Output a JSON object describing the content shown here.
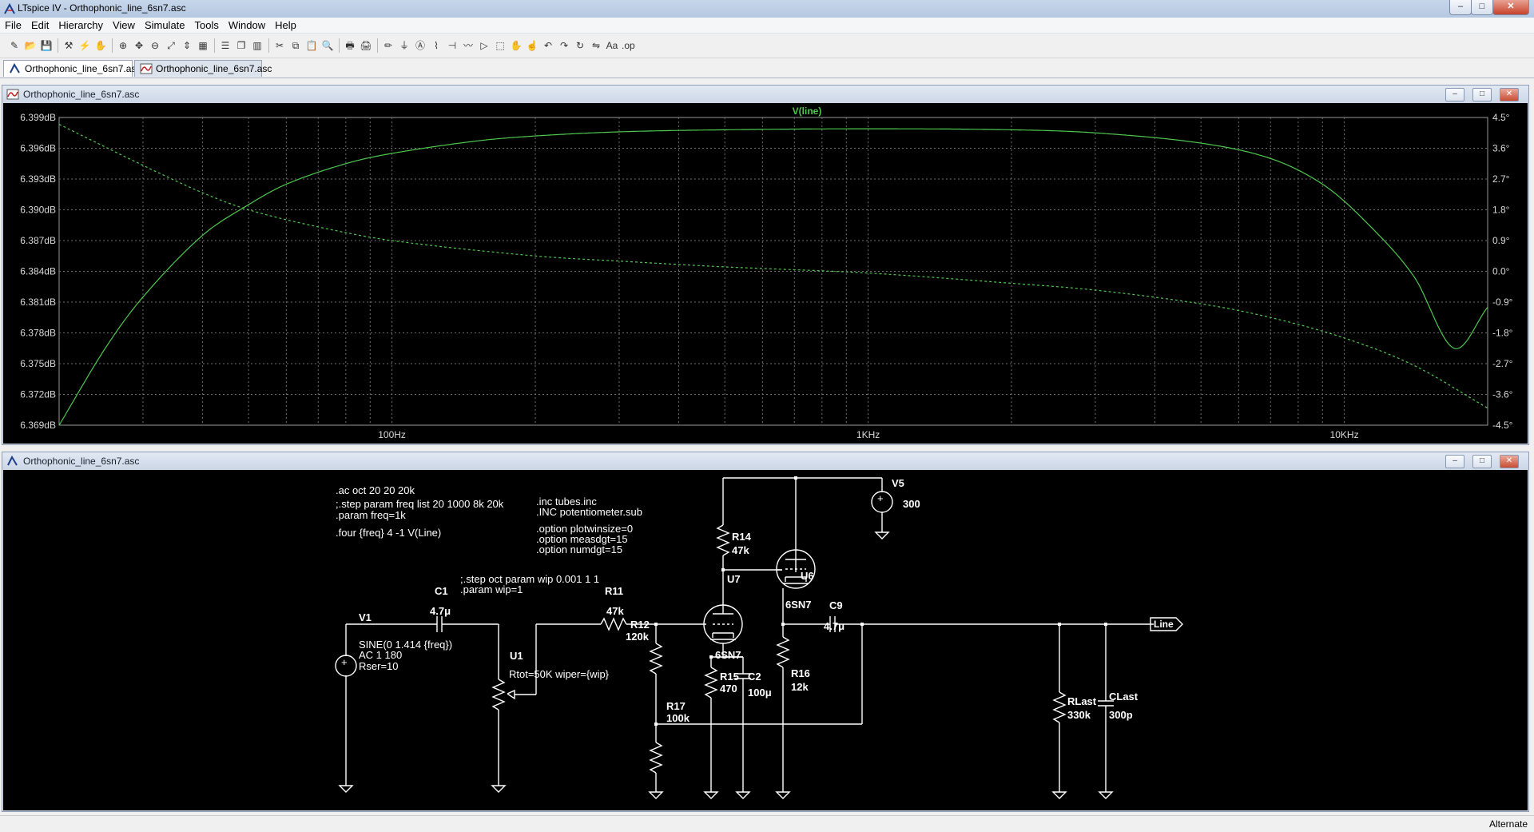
{
  "window": {
    "title": "LTspice IV - Orthophonic_line_6sn7.asc",
    "min_label": "–",
    "max_label": "□",
    "close_label": "✕"
  },
  "menu": [
    "File",
    "Edit",
    "Hierarchy",
    "View",
    "Simulate",
    "Tools",
    "Window",
    "Help"
  ],
  "toolbar_icons": [
    "new-schematic-icon",
    "open-icon",
    "save-icon",
    "control-panel-icon",
    "run-icon",
    "halt-icon",
    "zoom-in-icon",
    "pan-icon",
    "zoom-out-icon",
    "zoom-fit-icon",
    "autorange-icon",
    "grid-icon",
    "tile-horizontal-icon",
    "cascade-icon",
    "tile-vertical-icon",
    "cut-icon",
    "copy-icon",
    "paste-icon",
    "find-icon",
    "print-setup-icon",
    "print-icon",
    "draw-wire-icon",
    "ground-icon",
    "label-net-icon",
    "resistor-icon",
    "capacitor-icon",
    "inductor-icon",
    "diode-icon",
    "component-icon",
    "move-icon",
    "drag-icon",
    "undo-icon",
    "redo-icon",
    "rotate-icon",
    "mirror-icon",
    "text-icon",
    "spice-directive-icon"
  ],
  "tabs": [
    {
      "label": "Orthophonic_line_6sn7.asc",
      "icon": "schematic-icon"
    },
    {
      "label": "Orthophonic_line_6sn7.asc",
      "icon": "waveform-icon"
    }
  ],
  "waveform_window": {
    "title": "Orthophonic_line_6sn7.asc",
    "trace_name": "V(line)",
    "trace_color": "#4fc84f",
    "background": "#000000"
  },
  "chart_data": {
    "type": "line",
    "title": "V(line)",
    "xscale": "log",
    "xlim": [
      20,
      20000
    ],
    "x_tick_labels": [
      "100Hz",
      "1KHz",
      "10KHz"
    ],
    "x_ticks": [
      100,
      1000,
      10000
    ],
    "y_left_ticks": [
      "6.399dB",
      "6.396dB",
      "6.393dB",
      "6.390dB",
      "6.387dB",
      "6.384dB",
      "6.381dB",
      "6.378dB",
      "6.375dB",
      "6.372dB",
      "6.369dB"
    ],
    "y_left_lim": [
      6.369,
      6.399
    ],
    "y_right_ticks": [
      "4.5°",
      "3.6°",
      "2.7°",
      "1.8°",
      "0.9°",
      "0.0°",
      "-0.9°",
      "-1.8°",
      "-2.7°",
      "-3.6°",
      "-4.5°"
    ],
    "y_right_lim": [
      -4.5,
      4.5
    ],
    "grid": true,
    "series": [
      {
        "name": "V(line)",
        "style": "solid",
        "x": [
          20,
          25,
          30,
          40,
          50,
          60,
          80,
          100,
          150,
          200,
          300,
          500,
          1000,
          2000,
          3000,
          5000,
          7000,
          9000,
          11000,
          14000,
          17000,
          20000
        ],
        "y": [
          6.369,
          6.3765,
          6.3815,
          6.3875,
          6.3905,
          6.3925,
          6.3945,
          6.3955,
          6.3967,
          6.3972,
          6.3976,
          6.3978,
          6.3979,
          6.3978,
          6.3975,
          6.3965,
          6.395,
          6.3925,
          6.389,
          6.3835,
          6.3765,
          6.3805
        ]
      },
      {
        "name": "phase",
        "style": "dashed",
        "x": [
          20,
          30,
          40,
          50,
          70,
          100,
          200,
          300,
          500,
          1000,
          2000,
          3000,
          5000,
          7000,
          10000,
          14000,
          20000
        ],
        "y": [
          4.3,
          3.1,
          2.3,
          1.8,
          1.3,
          0.9,
          0.45,
          0.3,
          0.13,
          -0.05,
          -0.35,
          -0.55,
          -0.95,
          -1.35,
          -1.95,
          -2.75,
          -4.0
        ]
      }
    ]
  },
  "schematic_window": {
    "title": "Orthophonic_line_6sn7.asc",
    "background": "#000000",
    "wire_color": "#ffffff",
    "directives": {
      "d1": ".ac oct 20 20 20k",
      "d2": ";.step param freq list 20 1000 8k 20k",
      "d3": ".param freq=1k",
      "d4": ".four {freq} 4 -1 V(Line)",
      "d5": ".inc tubes.inc",
      "d6": ".INC potentiometer.sub",
      "d7": ".option plotwinsize=0",
      "d8": ".option measdgt=15",
      "d9": ".option numdgt=15",
      "d10": ";.step oct param wip 0.001 1 1",
      "d11": ".param wip=1"
    },
    "components": {
      "v1_name": "V1",
      "v1_val1": "SINE(0 1.414 {freq})",
      "v1_val2": "AC 1 180",
      "v1_val3": "Rser=10",
      "c1_name": "C1",
      "c1_val": "4.7μ",
      "u1_name": "U1",
      "u1_val": "Rtot=50K wiper={wip}",
      "r11_name": "R11",
      "r11_val": "47k",
      "r12_name": "R12",
      "r12_val": "120k",
      "r17_name": "R17",
      "r17_val": "100k",
      "u7_name": "U7",
      "u7_val": "6SN7",
      "r15_name": "R15",
      "r15_val": "470",
      "c2_name": "C2",
      "c2_val": "100μ",
      "r14_name": "R14",
      "r14_val": "47k",
      "u6_name": "U6",
      "u6_val": "6SN7",
      "r16_name": "R16",
      "r16_val": "12k",
      "c9_name": "C9",
      "c9_val": "4.7μ",
      "v5_name": "V5",
      "v5_val": "300",
      "rlast_name": "RLast",
      "rlast_val": "330k",
      "clast_name": "CLast",
      "clast_val": "300p",
      "net_label": "Line"
    }
  },
  "status": {
    "text": "Alternate"
  }
}
